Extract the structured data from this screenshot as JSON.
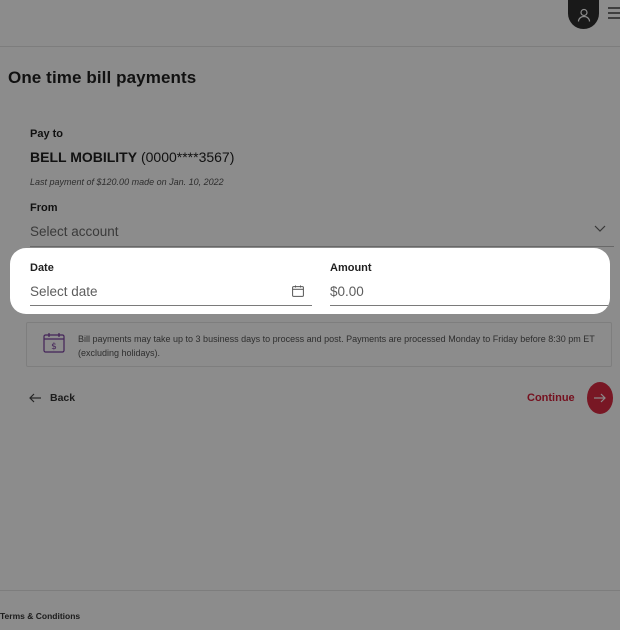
{
  "header": {
    "avatar_icon": "user-icon",
    "menu_icon": "hamburger-menu-icon"
  },
  "page": {
    "title": "One time bill payments"
  },
  "form": {
    "pay_to_label": "Pay to",
    "payee_name": "BELL MOBILITY",
    "payee_account": " (0000****3567)",
    "last_payment": "Last payment of $120.00 made on Jan. 10, 2022",
    "from_label": "From",
    "from_placeholder": "Select account",
    "date_label": "Date",
    "date_placeholder": "Select date",
    "amount_label": "Amount",
    "amount_placeholder": "$0.00"
  },
  "notice": {
    "icon": "calendar-dollar-icon",
    "text": "Bill payments may take up to 3 business days to process and post. Payments are processed Monday to Friday before 8:30 pm ET (excluding holidays)."
  },
  "actions": {
    "back_label": "Back",
    "continue_label": "Continue"
  },
  "footer": {
    "terms_label": "Terms & Conditions"
  },
  "colors": {
    "accent": "#da2b43",
    "overlay": "rgba(0,0,0,0.45)"
  }
}
